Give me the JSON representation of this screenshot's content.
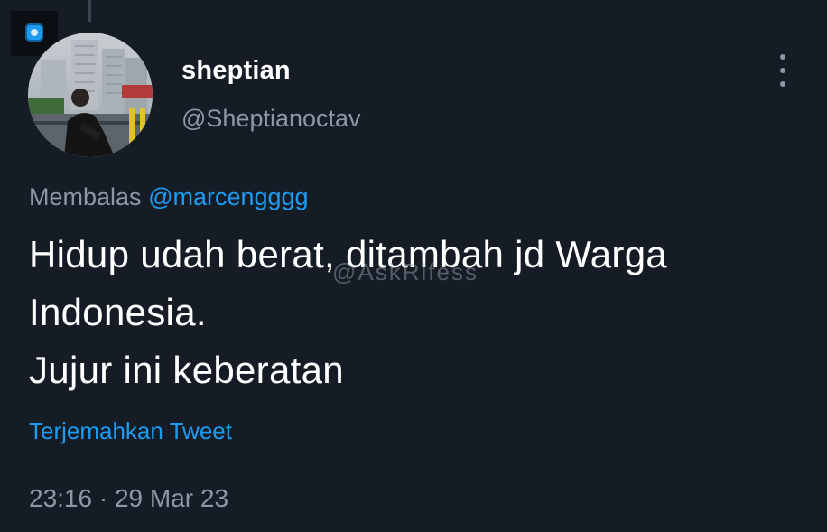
{
  "tweet": {
    "author": {
      "name": "sheptian",
      "handle": "@Sheptianoctav"
    },
    "reply": {
      "prefix": "Membalas",
      "mention": "@marcengggg"
    },
    "text_lines": [
      "Hidup udah berat, ditambah jd Warga",
      "Indonesia.",
      "Jujur ini keberatan"
    ],
    "watermark": "@AskRlfess",
    "translate_label": "Terjemahkan Tweet",
    "time": "23:16",
    "separator": "·",
    "date": "29 Mar 23"
  },
  "colors": {
    "background": "#151c26",
    "primary_text": "#ffffff",
    "secondary_text": "#8b98a5",
    "accent": "#1d9bf0"
  },
  "icons": {
    "more": "vertical-ellipsis-icon",
    "corner": "app-badge-icon"
  }
}
